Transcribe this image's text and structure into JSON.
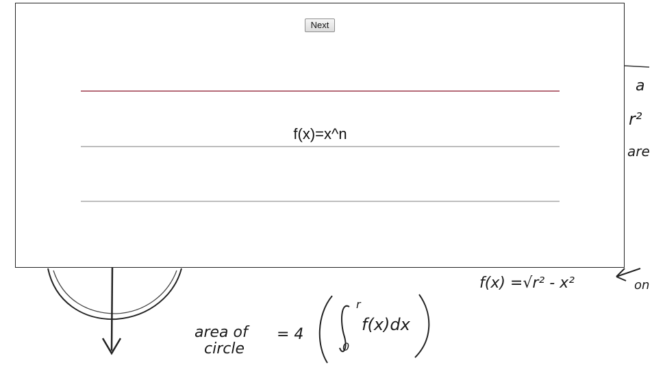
{
  "dialog": {
    "next_label": "Next",
    "formula": "f(x)=x^n"
  },
  "background": {
    "function_note": "f(x) =√r² - x²",
    "area_label_line1": "area of",
    "area_label_line2": "circle",
    "area_equals": "= 4",
    "integral_expr": "f(x)dx",
    "integral_upper": "r",
    "integral_lower": "0",
    "margin_r2": "r²",
    "margin_a": "a",
    "margin_are": "are",
    "margin_on": "on"
  }
}
